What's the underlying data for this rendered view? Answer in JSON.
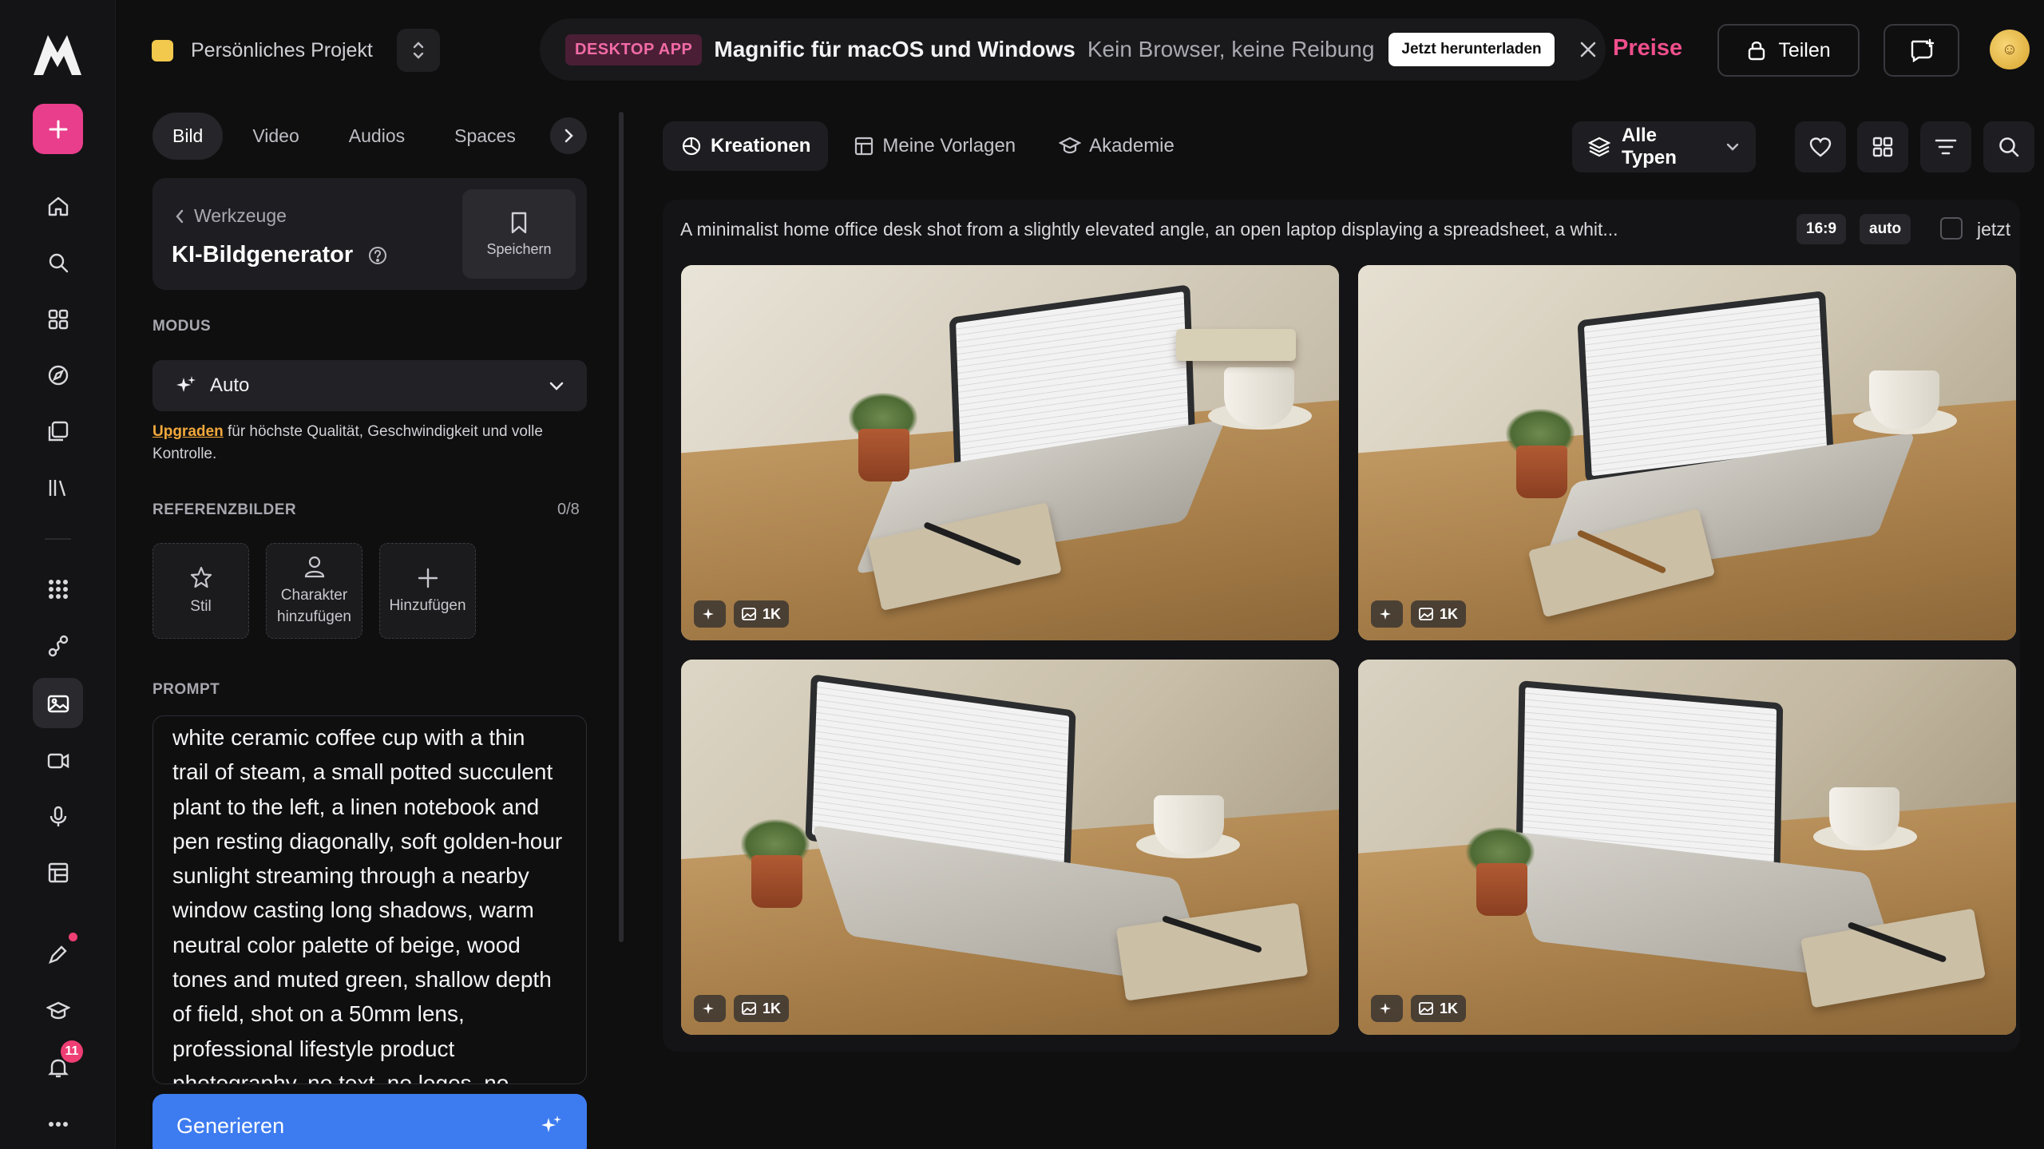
{
  "project": {
    "name": "Persönliches Projekt"
  },
  "banner": {
    "tag": "DESKTOP APP",
    "title": "Magnific für macOS und Windows",
    "subtitle": "Kein Browser, keine Reibung",
    "cta": "Jetzt herunterladen"
  },
  "header": {
    "pricing": "Preise",
    "share": "Teilen",
    "avatar_initial": "☺"
  },
  "sidebar": {
    "badge_count": "11",
    "icons": [
      "home-icon",
      "search-icon",
      "apps-icon",
      "explore-icon",
      "assets-icon",
      "library-icon",
      "grid-icon",
      "workflow-icon",
      "image-generator-icon",
      "video-icon",
      "audio-icon",
      "templates-icon",
      "pen-icon",
      "academy-icon",
      "bell-icon",
      "more-icon"
    ]
  },
  "media_tabs": [
    "Bild",
    "Video",
    "Audios",
    "Spaces"
  ],
  "tool": {
    "back_label": "Werkzeuge",
    "title": "KI-Bildgenerator",
    "save_label": "Speichern"
  },
  "mode": {
    "section_label": "MODUS",
    "value": "Auto",
    "upgrade_link": "Upgraden",
    "upgrade_text": "für höchste Qualität, Geschwindigkeit und volle Kontrolle."
  },
  "references": {
    "section_label": "REFERENZBILDER",
    "count": "0/8",
    "tiles": [
      {
        "label": "Stil"
      },
      {
        "label": "Charakter hinzufügen"
      },
      {
        "label": "Hinzufügen"
      }
    ]
  },
  "prompt": {
    "section_label": "PROMPT",
    "text": "white ceramic coffee cup with a thin trail of steam, a small potted succulent plant to the left, a linen notebook and pen resting diagonally, soft golden-hour sunlight streaming through a nearby window casting long shadows, warm neutral color palette of beige, wood tones and muted green, shallow depth of field, shot on a 50mm lens, professional lifestyle product photography, no text, no logos, no"
  },
  "generate": {
    "label": "Generieren"
  },
  "main_tabs": [
    {
      "label": "Kreationen",
      "icon": "creations-icon",
      "active": true
    },
    {
      "label": "Meine Vorlagen",
      "icon": "templates-icon",
      "active": false
    },
    {
      "label": "Akademie",
      "icon": "academy-icon",
      "active": false
    }
  ],
  "filter": {
    "type_label": "Alle Typen"
  },
  "generation": {
    "prompt_preview": "A minimalist home office desk shot from a slightly elevated angle, an open laptop displaying a spreadsheet, a whit...",
    "aspect": "16:9",
    "size_mode": "auto",
    "time": "jetzt",
    "images": [
      {
        "resolution": "1K"
      },
      {
        "resolution": "1K"
      },
      {
        "resolution": "1K"
      },
      {
        "resolution": "1K"
      }
    ]
  }
}
